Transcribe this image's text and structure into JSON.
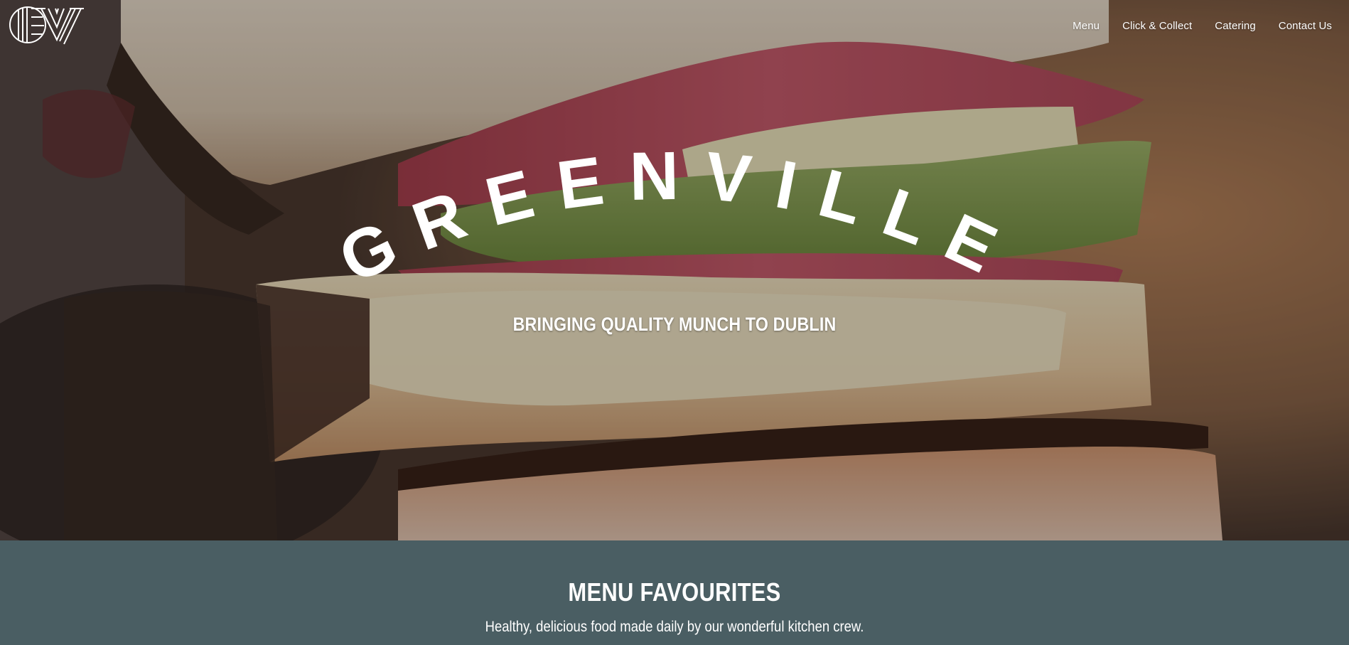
{
  "brand": {
    "logo_text": "GV",
    "title": "GREENVILLE",
    "tagline": "BRINGING QUALITY MUNCH TO DUBLIN"
  },
  "nav": {
    "items": [
      {
        "label": "Menu"
      },
      {
        "label": "Click & Collect"
      },
      {
        "label": "Catering"
      },
      {
        "label": "Contact Us"
      }
    ]
  },
  "favourites": {
    "heading": "MENU FAVOURITES",
    "subheading": "Healthy, delicious food made daily by our wonderful kitchen crew."
  },
  "colors": {
    "section_bg": "#4a5e63",
    "text": "#ffffff"
  }
}
